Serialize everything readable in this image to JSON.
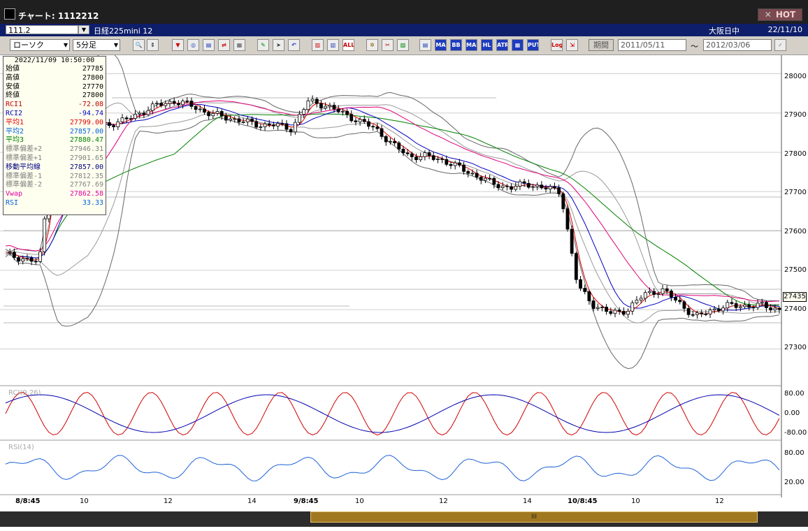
{
  "window": {
    "title": "チャート: 1112212",
    "hot_label": "HOT"
  },
  "symbol": {
    "code": "111.2",
    "name": "日経225mini 12",
    "market": "大阪日中",
    "date": "22/11/10"
  },
  "toolbar": {
    "chart_type": "ローソク",
    "interval": "5分足",
    "buttons": [
      "ALL",
      "MA",
      "BB",
      "MAE",
      "HL",
      "ATR",
      "PUT",
      "Log"
    ],
    "period_label": "期間",
    "date_from": "2011/05/11",
    "date_to": "2012/03/06",
    "tilde": "～"
  },
  "info_panel": {
    "datetime": "2022/11/09 10:50:00",
    "rows": [
      {
        "label": "始値",
        "value": "27785",
        "color": "#000000"
      },
      {
        "label": "高値",
        "value": "27800",
        "color": "#000000"
      },
      {
        "label": "安値",
        "value": "27770",
        "color": "#000000"
      },
      {
        "label": "終値",
        "value": "27800",
        "color": "#000000"
      },
      {
        "label": "RCI1",
        "value": "-72.08",
        "color": "#c00000"
      },
      {
        "label": "RCI2",
        "value": "-94.74",
        "color": "#0000c0"
      },
      {
        "label": "平均1",
        "value": "27799.00",
        "color": "#e00000"
      },
      {
        "label": "平均2",
        "value": "27857.00",
        "color": "#0060e0"
      },
      {
        "label": "平均3",
        "value": "27880.47",
        "color": "#008000"
      },
      {
        "label": "標準偏差+2",
        "value": "27946.31",
        "color": "#808080"
      },
      {
        "label": "標準偏差+1",
        "value": "27901.65",
        "color": "#808080"
      },
      {
        "label": "移動平均線",
        "value": "27857.00",
        "color": "#000080"
      },
      {
        "label": "標準偏差-1",
        "value": "27812.35",
        "color": "#808080"
      },
      {
        "label": "標準偏差-2",
        "value": "27767.69",
        "color": "#808080"
      },
      {
        "label": "Vwap",
        "value": "27862.58",
        "color": "#e000a0"
      },
      {
        "label": "RSI",
        "value": "33.33",
        "color": "#0060e0"
      }
    ]
  },
  "price_axis": {
    "ticks": [
      "28000",
      "27900",
      "27800",
      "27700",
      "27600",
      "27500",
      "27400",
      "27300"
    ],
    "current": "27435"
  },
  "rci_panel": {
    "label": "RCI(9,26)",
    "ticks": [
      "80.00",
      "0.00",
      "-80.00"
    ]
  },
  "rsi_panel": {
    "label": "RSI(14)",
    "ticks": [
      "80.00",
      "20.00"
    ]
  },
  "time_axis": {
    "ticks": [
      "8/8:45",
      "10",
      "12",
      "14",
      "9/8:45",
      "10",
      "12",
      "14",
      "10/8:45",
      "10",
      "12"
    ]
  },
  "scroll": {
    "grip": "III"
  },
  "chart_data": {
    "type": "candlestick",
    "price_range": [
      27210,
      28040
    ],
    "closes": [
      27540,
      27530,
      27520,
      27870,
      27860,
      27880,
      27870,
      27880,
      27900,
      27920,
      27930,
      27920,
      27900,
      27890,
      27880,
      27870,
      27870,
      27860,
      27930,
      27920,
      27900,
      27880,
      27860,
      27820,
      27790,
      27790,
      27780,
      27760,
      27740,
      27720,
      27710,
      27720,
      27710,
      27700,
      27460,
      27410,
      27390,
      27400,
      27440,
      27450,
      27420,
      27380,
      27400,
      27410,
      27410,
      27410,
      27400
    ],
    "rci_range": [
      -100,
      100
    ],
    "rsi_range": [
      0,
      100
    ]
  }
}
